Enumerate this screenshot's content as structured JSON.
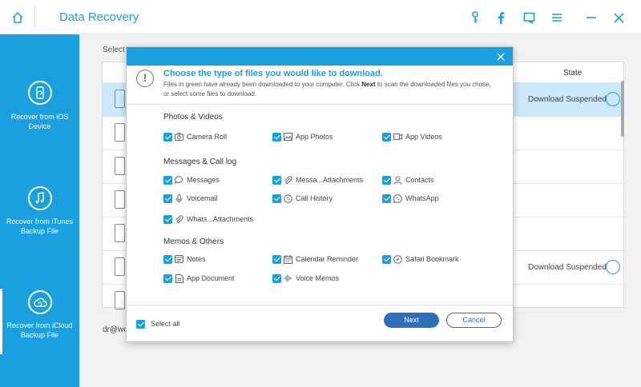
{
  "window": {
    "title": "Data Recovery",
    "accent_color": "#1a9fe0",
    "toolbar_icons": [
      "home-icon",
      "key-icon",
      "facebook-icon",
      "chat-icon",
      "menu-icon",
      "minimize-icon",
      "close-icon"
    ]
  },
  "sidebar": {
    "items": [
      {
        "label": "Recover from iOS Device",
        "icon": "phone-recover-icon"
      },
      {
        "label": "Recover from iTunes Backup File",
        "icon": "music-note-icon"
      },
      {
        "label": "Recover from iCloud Backup File",
        "icon": "cloud-icon",
        "active": true
      }
    ]
  },
  "main": {
    "select_label": "Select a",
    "table": {
      "state_header": "State",
      "rows": [
        {
          "state": "Download Suspended",
          "selected": true
        },
        {
          "state": ""
        },
        {
          "state": ""
        },
        {
          "state": ""
        },
        {
          "state": ""
        },
        {
          "state": "Download Suspended"
        },
        {
          "state": ""
        }
      ]
    },
    "email_label": "dr@wo"
  },
  "dialog": {
    "title": "Choose the type of files you would like to download.",
    "desc_before": "Files in green have already been downloaded to your computer. Click ",
    "desc_bold": "Next",
    "desc_after": " to scan the downloaded files you chose, or select some files to download.",
    "sections": [
      {
        "title": "Photos & Videos",
        "options": [
          {
            "label": "Camera Roll",
            "icon": "camera-icon",
            "checked": true
          },
          {
            "label": "App Photos",
            "icon": "image-icon",
            "checked": true
          },
          {
            "label": "App Videos",
            "icon": "video-icon",
            "checked": true
          }
        ]
      },
      {
        "title": "Messages & Call log",
        "options": [
          {
            "label": "Messages",
            "icon": "message-icon",
            "checked": true
          },
          {
            "label": "Messa...Attachments",
            "icon": "paperclip-icon",
            "checked": true
          },
          {
            "label": "Contacts",
            "icon": "contact-icon",
            "checked": true
          },
          {
            "label": "Voicemail",
            "icon": "microphone-icon",
            "checked": true
          },
          {
            "label": "Call History",
            "icon": "phone-icon",
            "checked": true
          },
          {
            "label": "WhatsApp",
            "icon": "whatsapp-icon",
            "checked": true
          },
          {
            "label": "Whats...Attachments",
            "icon": "paperclip-icon",
            "checked": true
          }
        ]
      },
      {
        "title": "Memos & Others",
        "options": [
          {
            "label": "Notes",
            "icon": "notes-icon",
            "checked": true
          },
          {
            "label": "Calendar  Reminder",
            "icon": "calendar-icon",
            "checked": true
          },
          {
            "label": "Safari Bookmark",
            "icon": "compass-icon",
            "checked": true
          },
          {
            "label": "App Document",
            "icon": "document-icon",
            "checked": true
          },
          {
            "label": "Voice Memos",
            "icon": "waveform-icon",
            "checked": true
          }
        ]
      }
    ],
    "select_all_label": "Select all",
    "next_label": "Next",
    "cancel_label": "Cancel"
  }
}
